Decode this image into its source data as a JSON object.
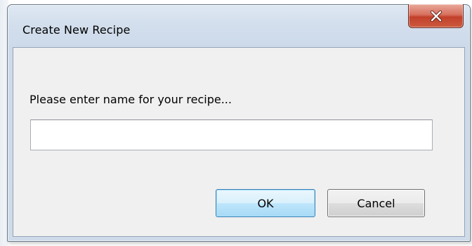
{
  "dialog": {
    "title": "Create New Recipe",
    "close_icon": "close-icon",
    "prompt": "Please enter name for your recipe...",
    "name_input": {
      "value": "",
      "placeholder": ""
    },
    "ok_label": "OK",
    "cancel_label": "Cancel"
  },
  "colors": {
    "close_button": "#c2402a",
    "ok_button_border": "#3c7fb1",
    "dialog_face": "#f0f0f0"
  }
}
